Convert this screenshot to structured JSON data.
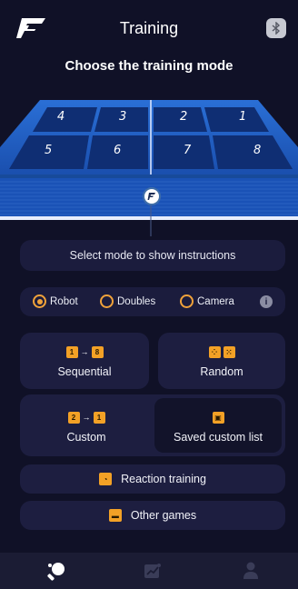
{
  "header": {
    "title": "Training",
    "logo_icon": "brand-logo-icon",
    "bluetooth_icon": "bluetooth-icon"
  },
  "subtitle": "Choose the training mode",
  "court": {
    "zones": [
      "4",
      "3",
      "2",
      "1",
      "5",
      "6",
      "7",
      "8"
    ],
    "net_icon": "brand-ball-icon"
  },
  "instructions": "Select mode to show instructions",
  "modes": {
    "options": [
      "Robot",
      "Doubles",
      "Camera"
    ],
    "selected": "Robot",
    "info_icon": "info-icon"
  },
  "cards": {
    "sequential": {
      "label": "Sequential",
      "icon_a": "1",
      "icon_b": "8"
    },
    "random": {
      "label": "Random"
    },
    "custom": {
      "label": "Custom",
      "icon_a": "2",
      "icon_b": "1"
    },
    "saved": {
      "label": "Saved custom list"
    }
  },
  "rows": {
    "reaction": {
      "label": "Reaction training",
      "icon": "timer-icon"
    },
    "other": {
      "label": "Other games",
      "icon": "gamepad-icon"
    }
  },
  "nav": {
    "items": [
      "paddle-icon",
      "chart-icon",
      "profile-icon"
    ],
    "active": "paddle-icon"
  },
  "colors": {
    "accent": "#f3a126",
    "court_blue": "#1f5cc2",
    "background": "#101127",
    "card": "#1d1e40"
  }
}
